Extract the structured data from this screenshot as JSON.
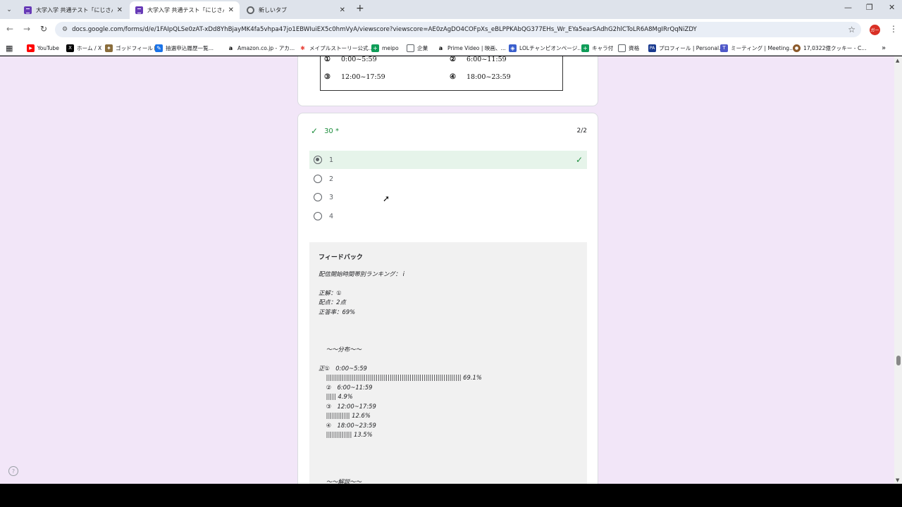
{
  "browser": {
    "tabs": [
      {
        "title": "大学入学 共通テスト「にじさんじ」",
        "active": false
      },
      {
        "title": "大学入学 共通テスト「にじさんじ」",
        "active": true
      },
      {
        "title": "新しいタブ",
        "active": false
      }
    ],
    "url": "docs.google.com/forms/d/e/1FAIpQLSe0zAT-xDd8YhBjayMK4fa5vhpa47jo1EBWIuiEX5c0hmVyA/viewscore?viewscore=AE0zAgDO4COFpXs_eBLPPKAbQG377EHs_Wr_EYa5earSAdhG2hlCToLR6A8MgIRrQqNiZDY",
    "profile_label": "ガー"
  },
  "bookmarks": [
    {
      "label": "YouTube",
      "icon": "youtube-icon",
      "color": "#ff0000"
    },
    {
      "label": "ホーム / X",
      "icon": "x-icon",
      "color": "#000000"
    },
    {
      "label": "ゴッドフィールド",
      "icon": "game-icon",
      "color": "#8a6d3b"
    },
    {
      "label": "抽選申込履歴一覧...",
      "icon": "ticket-icon",
      "color": "#1a73e8"
    },
    {
      "label": "Amazon.co.jp - アカ...",
      "icon": "amazon-icon",
      "color": "#000000"
    },
    {
      "label": "メイプルストーリー公式...",
      "icon": "maple-icon",
      "color": "#e8453c"
    },
    {
      "label": "meipo",
      "icon": "sheets-icon",
      "color": "#0f9d58"
    },
    {
      "label": "企業",
      "icon": "folder-icon",
      "color": "#5f6368"
    },
    {
      "label": "Prime Video | 映画、...",
      "icon": "amazon-icon",
      "color": "#000000"
    },
    {
      "label": "LOLチャンピオンページ...",
      "icon": "lol-icon",
      "color": "#3a5fcd"
    },
    {
      "label": "キャラ付",
      "icon": "sheets-icon",
      "color": "#0f9d58"
    },
    {
      "label": "資格",
      "icon": "folder-icon",
      "color": "#5f6368"
    },
    {
      "label": "プロフィール | Personal...",
      "icon": "profile-icon",
      "color": "#1a3a8f"
    },
    {
      "label": "ミーティング | Meeting...",
      "icon": "teams-icon",
      "color": "#5059c9"
    },
    {
      "label": "17,0322億クッキー - C...",
      "icon": "cookie-icon",
      "color": "#8b5a2b"
    }
  ],
  "prev_question": {
    "options": [
      {
        "num": "①",
        "range": "0:00~5:59"
      },
      {
        "num": "②",
        "range": "6:00~11:59"
      },
      {
        "num": "③",
        "range": "12:00~17:59"
      },
      {
        "num": "④",
        "range": "18:00~23:59"
      }
    ]
  },
  "question": {
    "title": "30 *",
    "score": "2/2",
    "options": [
      {
        "label": "1",
        "selected": true,
        "correct": true
      },
      {
        "label": "2",
        "selected": false,
        "correct": false
      },
      {
        "label": "3",
        "selected": false,
        "correct": false
      },
      {
        "label": "4",
        "selected": false,
        "correct": false
      }
    ]
  },
  "feedback": {
    "title": "フィードバック",
    "lines": [
      "配信開始時間帯別ランキング： i",
      "",
      "正解：①",
      "配点：2点",
      "正答率：69%",
      "",
      "",
      "",
      "    ～～分布～～",
      "",
      "正①　0:00~5:59",
      "    |||||||||||||||||||||||||||||||||||||||||||||||||||||||||||||||||||| 69.1%",
      "    ②　6:00~11:59",
      "    ||||| 4.9%",
      "    ③　12:00~17:59",
      "    |||||||||||| 12.6%",
      "    ④　18:00~23:59",
      "    ||||||||||||| 13.5%",
      "",
      "",
      "",
      "",
      "    ～～解説～～"
    ]
  },
  "colors": {
    "page_bg": "#f2e6f8",
    "correct_green": "#1e8e3e",
    "correct_bg": "#e6f4ea",
    "form_accent": "#673ab7"
  }
}
